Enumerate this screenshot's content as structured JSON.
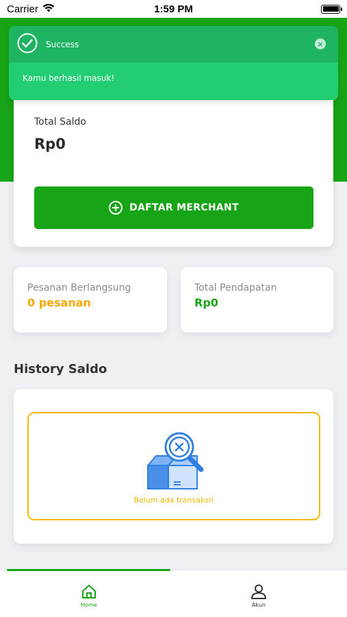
{
  "status_bar": {
    "carrier": "Carrier",
    "time": "1:59 PM"
  },
  "toast": {
    "title": "Success",
    "message": "Kamu berhasil masuk!",
    "close_icon": "close-icon",
    "success_icon": "check-circle-icon"
  },
  "balance": {
    "label": "Total Saldo",
    "value": "Rp0",
    "merchant_button": "DAFTAR MERCHANT"
  },
  "stats": {
    "orders_label": "Pesanan Berlangsung",
    "orders_value": "0 pesanan",
    "income_label": "Total Pendapatan",
    "income_value": "Rp0"
  },
  "history": {
    "title": "History Saldo",
    "empty_text": "Belum ada transaksi!"
  },
  "nav": {
    "home_label": "Home",
    "account_label": "Akun"
  },
  "colors": {
    "primary": "#17a517",
    "toast": "#22cd74",
    "accent_orange": "#f5a800",
    "empty_border": "#f5b800"
  }
}
